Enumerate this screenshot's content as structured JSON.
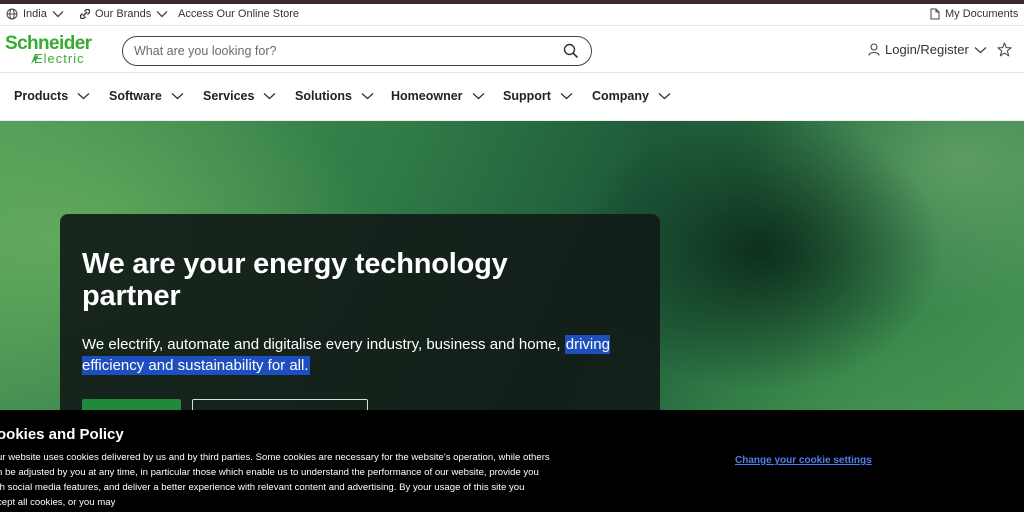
{
  "utility_bar": {
    "country": "India",
    "brands": "Our Brands",
    "store": "Access Our Online Store",
    "documents": "My Documents"
  },
  "header": {
    "logo_line1": "Schneider",
    "logo_line2": "Electric",
    "search_placeholder": "What are you looking for?",
    "login": "Login/Register"
  },
  "nav": {
    "items": [
      {
        "label": "Products"
      },
      {
        "label": "Software"
      },
      {
        "label": "Services"
      },
      {
        "label": "Solutions"
      },
      {
        "label": "Homeowner"
      },
      {
        "label": "Support"
      },
      {
        "label": "Company"
      }
    ]
  },
  "hero": {
    "title": "We are your energy technology partner",
    "description_plain": "We electrify, automate and digitalise every industry, business and home, ",
    "description_highlight": "driving efficiency and sustainability for all."
  },
  "cookie": {
    "title": "ookies and Policy",
    "lines": [
      "ur website uses cookies delivered by us and by third parties. Some cookies are necessary for the website's operation, while others",
      "n be adjusted by you at any time, in particular those which enable us to understand the performance of our website, provide you",
      "th social media features, and deliver a better experience with relevant content and advertising. By your usage of this site you",
      "cept all cookies, or you may"
    ],
    "settings_link": "Change your cookie settings"
  },
  "colors": {
    "brand_green": "#3aaa35",
    "highlight": "#1f4fbf",
    "link_blue": "#4c7ff0",
    "cta_green": "#1f8a3a"
  }
}
